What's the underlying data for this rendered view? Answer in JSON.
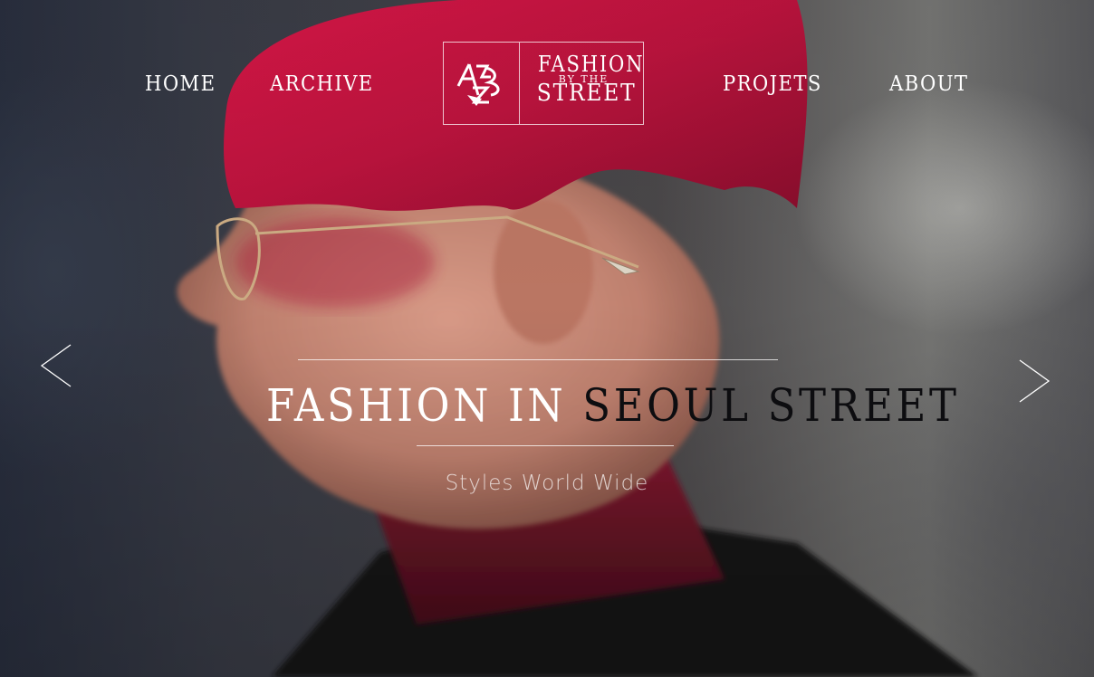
{
  "nav": {
    "home": "HOME",
    "archive": "ARCHIVE",
    "projets": "PROJETS",
    "about": "ABOUT"
  },
  "logo": {
    "line1": "FASHION",
    "line2": "BY THE",
    "line3": "STREET"
  },
  "hero": {
    "headline_part1": "FASHION IN ",
    "headline_part2": "SEOUL STREET",
    "subtitle": "Styles World Wide"
  },
  "icons": {
    "prev": "chevron-left-icon",
    "next": "chevron-right-icon"
  },
  "colors": {
    "accent_hair": "#c4143c",
    "headline_dark": "#0d0d10",
    "text_light": "#ffffff"
  }
}
